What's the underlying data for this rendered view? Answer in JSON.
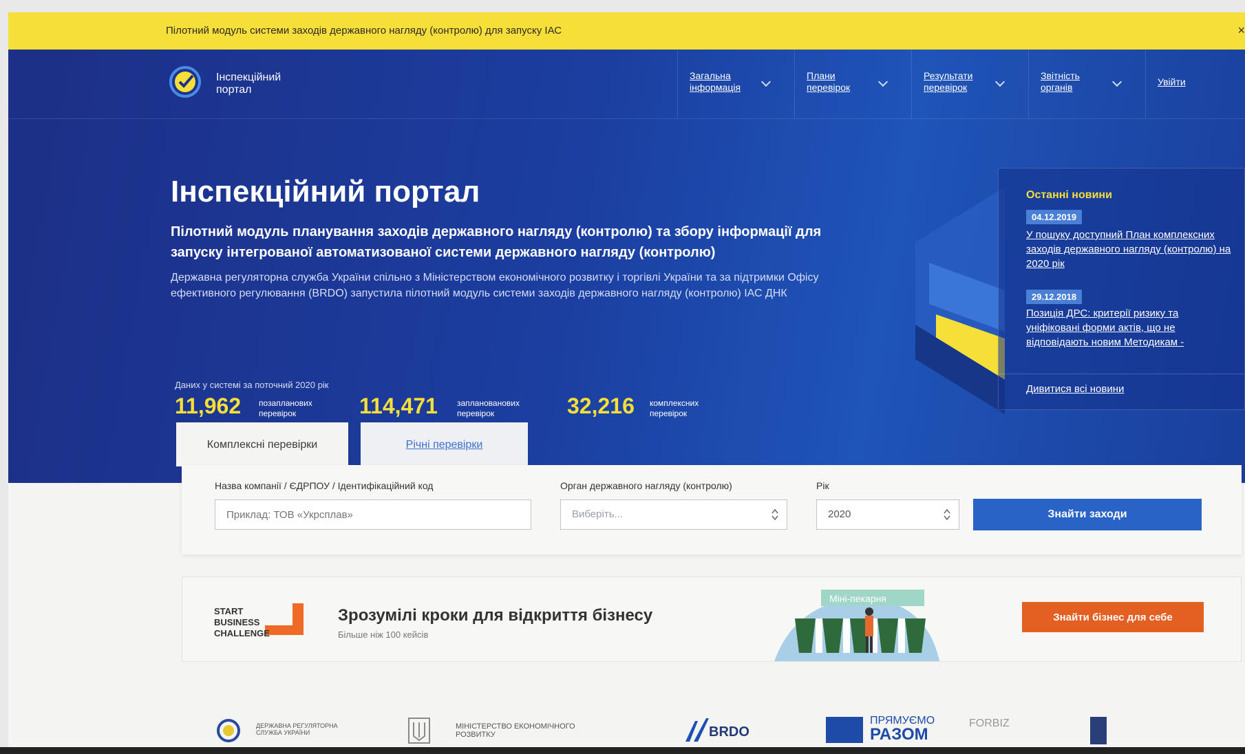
{
  "pilot_banner": {
    "text": "Пілотний модуль системи заходів державного нагляду (контролю) для запуску ІАС",
    "close": "×"
  },
  "header": {
    "logo_text": "Інспекційний портал",
    "nav": [
      {
        "label": "Загальна інформація"
      },
      {
        "label": "Плани перевірок"
      },
      {
        "label": "Результати перевірок"
      },
      {
        "label": "Звітність органів"
      }
    ],
    "login": "Увійти"
  },
  "hero": {
    "title": "Інспекційний портал",
    "subtitle": "Пілотний модуль планування заходів державного нагляду (контролю) та збору інформації для запуску інтегрованої автоматизованої системи державного нагляду (контролю)",
    "description": "Державна регуляторна служба України спільно з Міністерством економічного розвитку і торгівлі України та за підтримки Офісу ефективного регулювання (BRDO) запустила пілотний модуль системи заходів державного нагляду (контролю) ІАС ДНК"
  },
  "stats": {
    "label": "Даних у системі за поточний 2020 рік",
    "items": [
      {
        "value": "11,962",
        "label": "позапланових перевірок"
      },
      {
        "value": "114,471",
        "label": "запланованових перевірок"
      },
      {
        "value": "32,216",
        "label": "комплексних перевірок"
      }
    ]
  },
  "news": {
    "title": "Останні новини",
    "items": [
      {
        "date": "04.12.2019",
        "text": "У пошуку доступний План комплексних заходів державного нагляду (контролю) на 2020 рік"
      },
      {
        "date": "29.12.2018",
        "text": "Позиція ДРС: критерії ризику та уніфіковані форми актів, що не відповідають новим Методикам -"
      }
    ],
    "all_link": "Дивитися всі новини"
  },
  "tabs": {
    "active": "Комплексні перевірки",
    "inactive": "Річні перевірки"
  },
  "search": {
    "company_label": "Назва компанії / ЄДРПОУ / Ідентифікаційний код",
    "company_placeholder": "Приклад: ТОВ «Укрсплав»",
    "authority_label": "Орган державного нагляду (контролю)",
    "authority_value": "Виберіть...",
    "year_label": "Рік",
    "year_value": "2020",
    "button": "Знайти заходи"
  },
  "sbc": {
    "logo_lines": [
      "START",
      "BUSINESS",
      "CHALLENGE"
    ],
    "title": "Зрозумілі кроки для відкриття бізнесу",
    "subtitle": "Більше ніж 100 кейсів",
    "illus_sign": "Міні-пекарня",
    "button": "Знайти бізнес для себе"
  },
  "partners": {
    "drs": "ДЕРЖАВНА РЕГУЛЯТОРНА СЛУЖБА УКРАЇНИ",
    "ministry": "МІНІСТЕРСТВО ЕКОНОМІЧНОГО РОЗВИТКУ",
    "brdo": "BRDO",
    "razom_top": "ПРЯМУЄМО",
    "razom_bottom": "РАЗОМ",
    "forbiz": "FORBIZ"
  },
  "colors": {
    "accent_yellow": "#f6df38",
    "hero_blue": "#1b3ea0",
    "button_blue": "#2a63c6",
    "button_orange": "#e35f22"
  }
}
